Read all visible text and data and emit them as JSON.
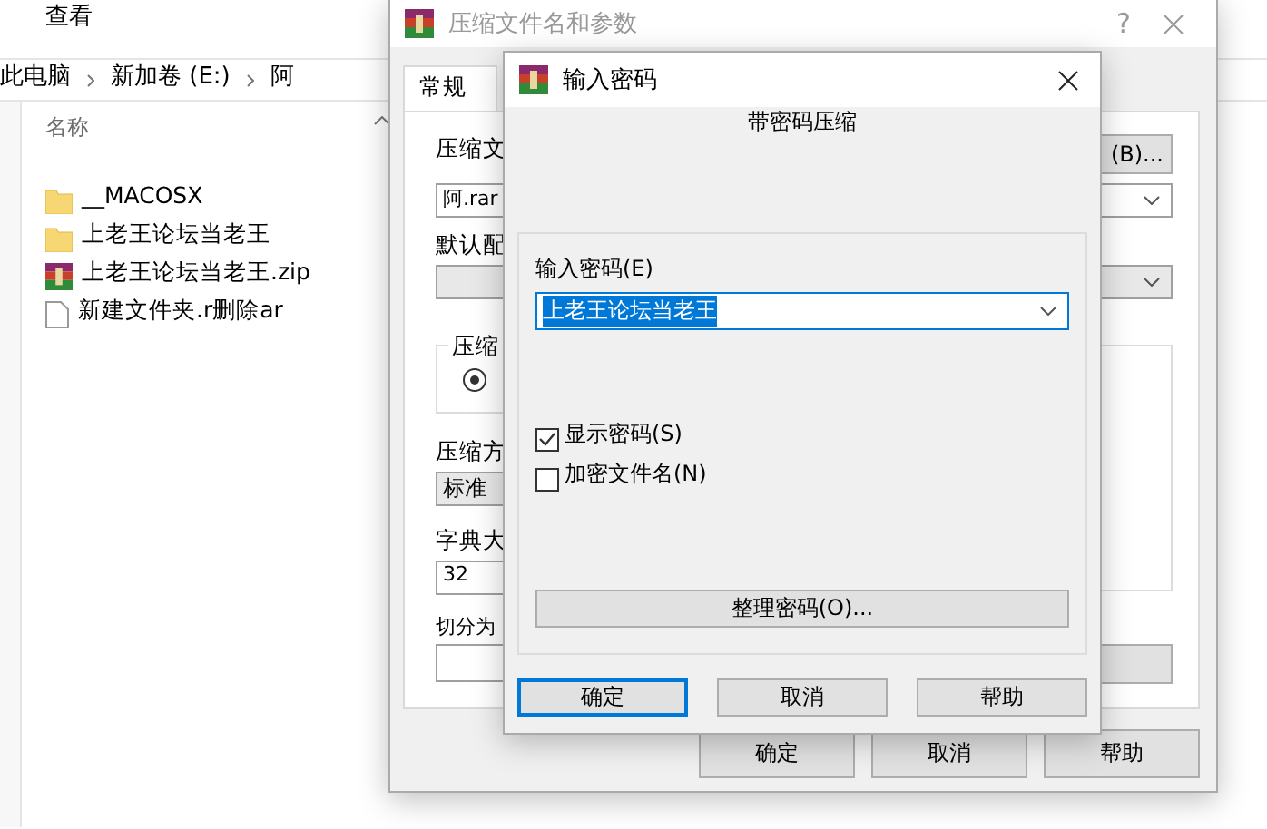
{
  "explorer": {
    "menu": "查看",
    "breadcrumb": [
      "此电脑",
      "新加卷 (E:)",
      "阿"
    ],
    "column_header": "名称",
    "files": [
      {
        "name": "__MACOSX",
        "kind": "folder"
      },
      {
        "name": "上老王论坛当老王",
        "kind": "folder"
      },
      {
        "name": "上老王论坛当老王.zip",
        "kind": "archive"
      },
      {
        "name": "新建文件夹.r删除ar",
        "kind": "file"
      }
    ]
  },
  "archive_dialog": {
    "title": "压缩文件名和参数",
    "help_glyph": "?",
    "tabs": [
      {
        "label": "常规",
        "selected": true
      }
    ],
    "filename_label": "压缩文",
    "browse_button": "(B)...",
    "filename_value": "阿.rar",
    "profile_label": "默认配",
    "format_group": "压缩",
    "format_radio_selected": true,
    "method_label": "压缩方",
    "method_value": "标准",
    "dict_label": "字典大",
    "dict_value": "32",
    "split_label": "切分为",
    "buttons": [
      "确定",
      "取消",
      "帮助"
    ]
  },
  "password_dialog": {
    "title": "输入密码",
    "heading": "带密码压缩",
    "password_label": "输入密码(E)",
    "password_value": "上老王论坛当老王",
    "checkboxes": [
      {
        "label": "显示密码(S)",
        "checked": true
      },
      {
        "label": "加密文件名(N)",
        "checked": false
      }
    ],
    "organize_button": "整理密码(O)...",
    "buttons": [
      {
        "label": "确定",
        "default": true
      },
      {
        "label": "取消",
        "default": false
      },
      {
        "label": "帮助",
        "default": false
      }
    ]
  }
}
